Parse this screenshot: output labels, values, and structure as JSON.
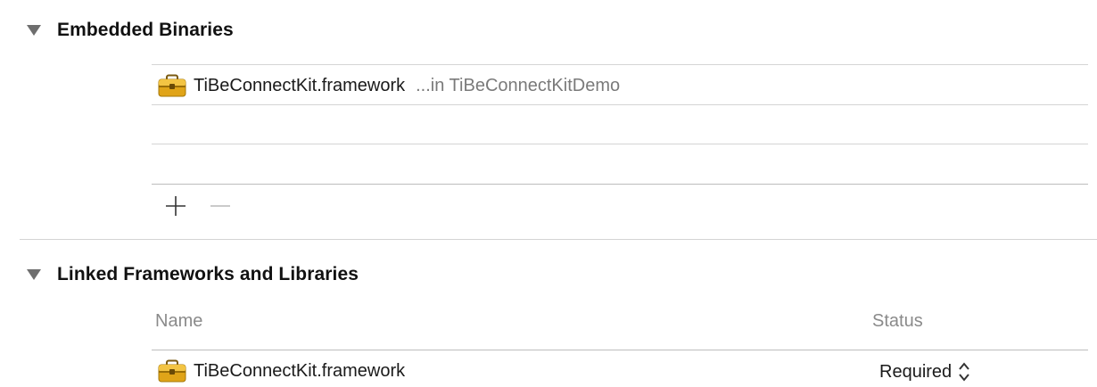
{
  "embedded": {
    "title": "Embedded Binaries",
    "items": [
      {
        "name": "TiBeConnectKit.framework",
        "path": "...in TiBeConnectKitDemo",
        "icon": "toolbox-icon"
      }
    ],
    "add_icon": "plus-icon",
    "remove_icon": "minus-icon"
  },
  "linked": {
    "title": "Linked Frameworks and Libraries",
    "columns": {
      "name": "Name",
      "status": "Status"
    },
    "items": [
      {
        "name": "TiBeConnectKit.framework",
        "status": "Required",
        "icon": "toolbox-icon"
      }
    ]
  }
}
